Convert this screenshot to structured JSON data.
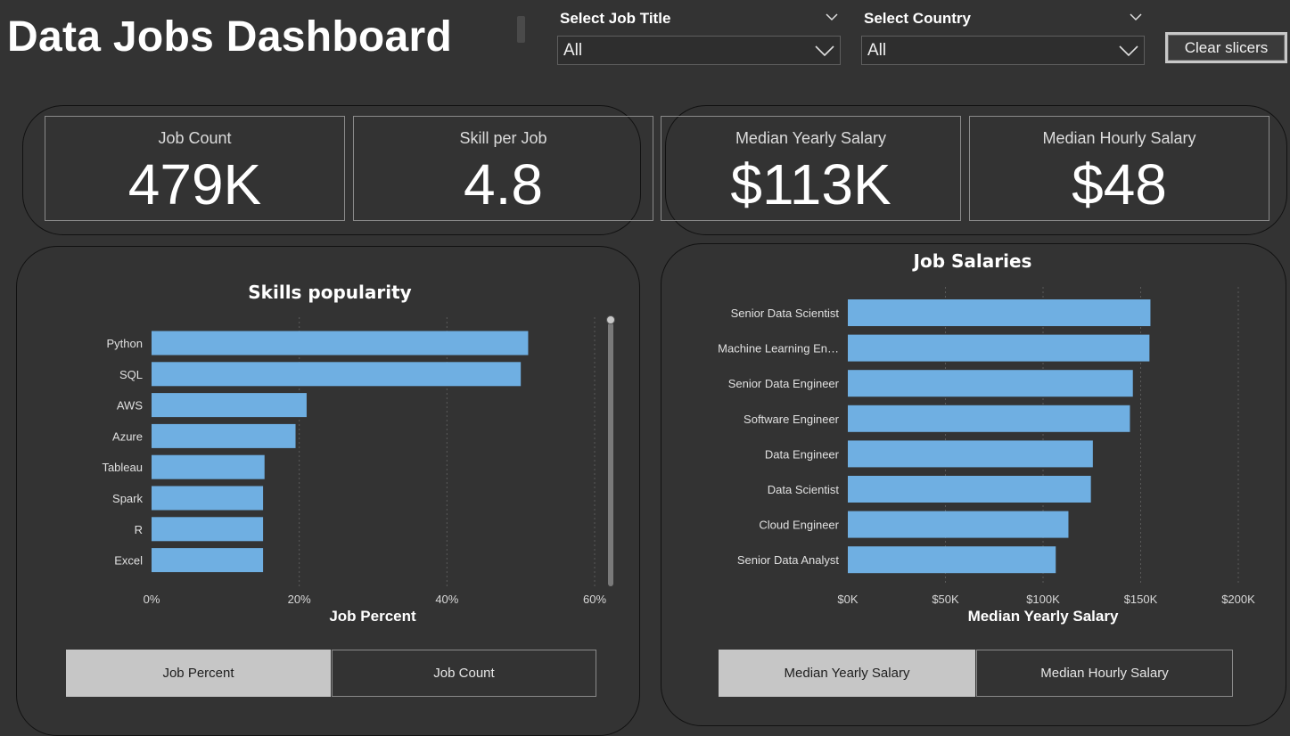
{
  "header": {
    "title": "Data Jobs Dashboard"
  },
  "slicers": {
    "job_title": {
      "label": "Select Job Title",
      "value": "All"
    },
    "country": {
      "label": "Select Country",
      "value": "All"
    },
    "clear_label": "Clear slicers"
  },
  "kpis": [
    {
      "label": "Job Count",
      "value": "479K"
    },
    {
      "label": "Skill per Job",
      "value": "4.8"
    },
    {
      "label": "Median Yearly Salary",
      "value": "$113K"
    },
    {
      "label": "Median Hourly Salary",
      "value": "$48"
    }
  ],
  "colors": {
    "background": "#333333",
    "bar": "#6fafe2",
    "toggle_selected": "#c6c6c6"
  },
  "chart_data": [
    {
      "type": "bar",
      "orientation": "horizontal",
      "title": "Skills popularity",
      "xlabel": "Job Percent",
      "ylabel": "",
      "categories": [
        "Python",
        "SQL",
        "AWS",
        "Azure",
        "Tableau",
        "Spark",
        "R",
        "Excel"
      ],
      "values": [
        51,
        50,
        21,
        19.5,
        15.3,
        15.1,
        15.1,
        15.1
      ],
      "x_ticks": [
        "0%",
        "20%",
        "40%",
        "60%"
      ],
      "xlim": [
        0,
        60
      ],
      "grid": true
    },
    {
      "type": "bar",
      "orientation": "horizontal",
      "title": "Job Salaries",
      "xlabel": "Median Yearly Salary",
      "ylabel": "",
      "categories": [
        "Senior Data Scientist",
        "Machine Learning En…",
        "Senior Data Engineer",
        "Software Engineer",
        "Data Engineer",
        "Data Scientist",
        "Cloud Engineer",
        "Senior Data Analyst"
      ],
      "values": [
        155000,
        154500,
        146000,
        144500,
        125500,
        124500,
        113000,
        106500
      ],
      "x_ticks": [
        "$0K",
        "$50K",
        "$100K",
        "$150K",
        "$200K"
      ],
      "xlim": [
        0,
        200000
      ],
      "grid": true
    }
  ],
  "toggles": {
    "skills": [
      {
        "label": "Job Percent",
        "selected": true
      },
      {
        "label": "Job Count",
        "selected": false
      }
    ],
    "salaries": [
      {
        "label": "Median Yearly Salary",
        "selected": true
      },
      {
        "label": "Median Hourly Salary",
        "selected": false
      }
    ]
  }
}
